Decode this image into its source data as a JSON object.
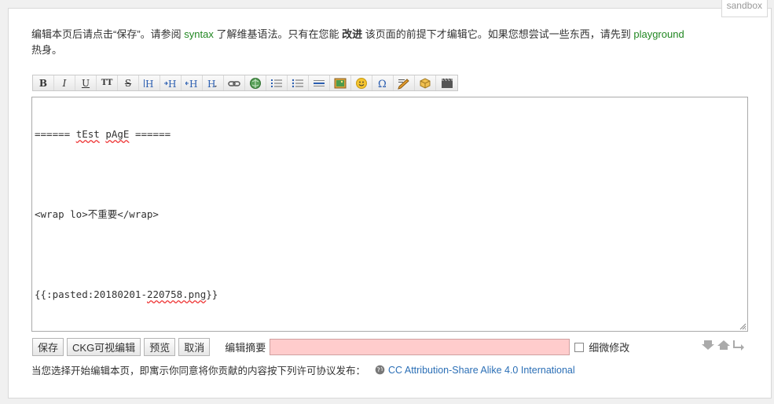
{
  "namespace_tab": "sandbox",
  "intro": {
    "part1": "编辑本页后请点击“保存”。请参阅 ",
    "syntax_link": "syntax",
    "part2": " 了解维基语法。只有在您能 ",
    "improve": "改进",
    "part3": " 该页面的前提下才编辑它。如果您想尝试一些东西，请先到 ",
    "playground_link": "playground",
    "part4": "热身。"
  },
  "toolbar": {
    "bold": "B",
    "italic": "I",
    "underline": "U",
    "mono": "TT",
    "strike": "S",
    "icons": [
      "bold-icon",
      "italic-icon",
      "underline-icon",
      "monospace-icon",
      "strikethrough-icon",
      "heading-same-icon",
      "heading-lower-icon",
      "heading-higher-icon",
      "heading-select-icon",
      "link-icon",
      "external-link-icon",
      "ordered-list-icon",
      "unordered-list-icon",
      "horizontal-rule-icon",
      "image-icon",
      "smiley-icon",
      "special-chars-icon",
      "signature-icon",
      "plugin-icon",
      "media-icon"
    ]
  },
  "editor": {
    "line1_a": "====== ",
    "line1_b": "tEst",
    "line1_c": " ",
    "line1_d": "pAgE",
    "line1_e": " ======",
    "line2": "<wrap lo>不重要</wrap>",
    "line3_a": "{{:pasted:20180201-",
    "line3_b": "220758.png",
    "line3_c": "}}"
  },
  "buttons": {
    "save": "保存",
    "ckg": "CKG可视编辑",
    "preview": "预览",
    "cancel": "取消"
  },
  "summary": {
    "label": "编辑摘要",
    "value": ""
  },
  "minor_edit_label": "细微修改",
  "license": {
    "text": "当您选择开始编辑本页，即寓示你同意将你贡献的内容按下列许可协议发布：",
    "link": "CC Attribution-Share Alike 4.0 International"
  },
  "colors": {
    "link_green": "#218721",
    "link_blue": "#2b6fb6",
    "summary_bg": "#ffcccc"
  }
}
